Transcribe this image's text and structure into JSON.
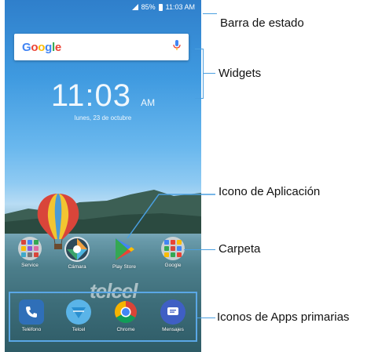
{
  "status_bar": {
    "battery": "85%",
    "time": "11:03 AM"
  },
  "search": {
    "brand": [
      "G",
      "o",
      "o",
      "g",
      "l",
      "e"
    ]
  },
  "clock": {
    "time": "11:03",
    "ampm": "AM",
    "date": "lunes, 23 de octubre"
  },
  "watermark": "telcel",
  "apps": [
    {
      "label": "Service"
    },
    {
      "label": "Cámara"
    },
    {
      "label": "Play Store"
    },
    {
      "label": "Google"
    }
  ],
  "dock": [
    {
      "label": "Teléfono"
    },
    {
      "label": "Telcel"
    },
    {
      "label": "Chrome"
    },
    {
      "label": "Mensajes"
    }
  ],
  "callouts": {
    "status": "Barra de estado",
    "widgets": "Widgets",
    "app_icon": "Icono de Aplicación",
    "folder": "Carpeta",
    "primary": "Iconos de Apps primarias"
  },
  "colors": {
    "accent": "#4a9fe0"
  }
}
